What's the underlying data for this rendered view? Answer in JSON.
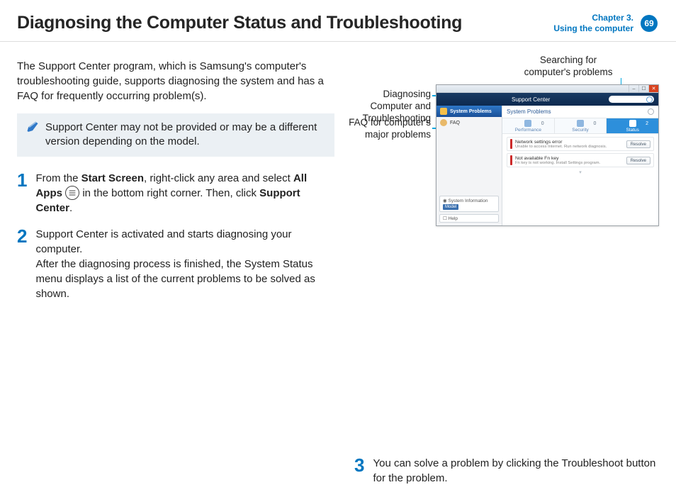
{
  "header": {
    "title": "Diagnosing the Computer Status and Troubleshooting",
    "chapter_line1": "Chapter 3.",
    "chapter_line2": "Using the computer",
    "page_number": "69"
  },
  "intro": "The Support Center program, which is Samsung's computer's troubleshooting guide, supports diagnosing the system and has a FAQ for frequently occurring problem(s).",
  "note": "Support Center may not be provided or may be a different version depending on the model.",
  "steps": {
    "s1": {
      "num": "1",
      "a": "From the ",
      "b": "Start Screen",
      "c": ", right-click any area and select ",
      "d": "All Apps",
      "e": " in the bottom right corner. Then, click ",
      "f": "Support Center",
      "g": "."
    },
    "s2": {
      "num": "2",
      "a": "Support Center is activated and starts diagnosing your computer.",
      "b": "After the diagnosing process is finished, the System Status menu displays a list of the current problems to be solved as shown."
    },
    "s3": {
      "num": "3",
      "t": "You can solve a problem by clicking the Troubleshoot button for the problem."
    }
  },
  "callouts": {
    "diagnose": "Diagnosing Computer and Troubleshooting",
    "faq": "FAQ for computer's major problems",
    "search": "Searching for computer's problems"
  },
  "sc": {
    "window_title": "Support Center",
    "side": {
      "system_problems": "System Problems",
      "faq": "FAQ",
      "sysinfo_label": "System Information",
      "model_label": "Model",
      "help": "Help"
    },
    "main": {
      "heading": "System Problems",
      "tabs": {
        "performance": {
          "label": "Performance",
          "count": "0"
        },
        "security": {
          "label": "Security",
          "count": "0"
        },
        "status": {
          "label": "Status",
          "count": "2"
        }
      },
      "problems": [
        {
          "title": "Network settings error",
          "sub": "Unable to access Internet. Run network diagnosis.",
          "btn": "Resolve"
        },
        {
          "title": "Not available Fn key",
          "sub": "Fn key is not working. Install Settings program.",
          "btn": "Resolve"
        }
      ]
    }
  }
}
